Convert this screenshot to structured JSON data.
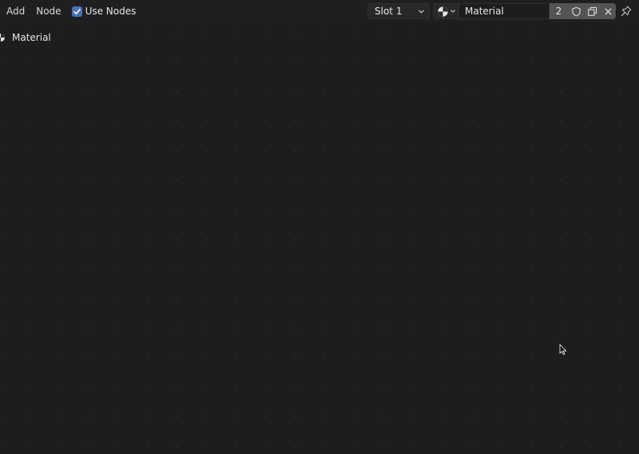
{
  "header": {
    "menu": [
      {
        "label": "Add"
      },
      {
        "label": "Node"
      }
    ],
    "use_nodes": {
      "label": "Use Nodes",
      "checked": true
    },
    "slot": {
      "selected": "Slot 1"
    },
    "material": {
      "name": "Material",
      "users": "2"
    }
  },
  "breadcrumb": {
    "label": "Material"
  },
  "colors": {
    "background": "#1d1d20",
    "header": "#1f1f22",
    "checkbox_accent": "#4772b3",
    "button_gray": "#545454"
  }
}
